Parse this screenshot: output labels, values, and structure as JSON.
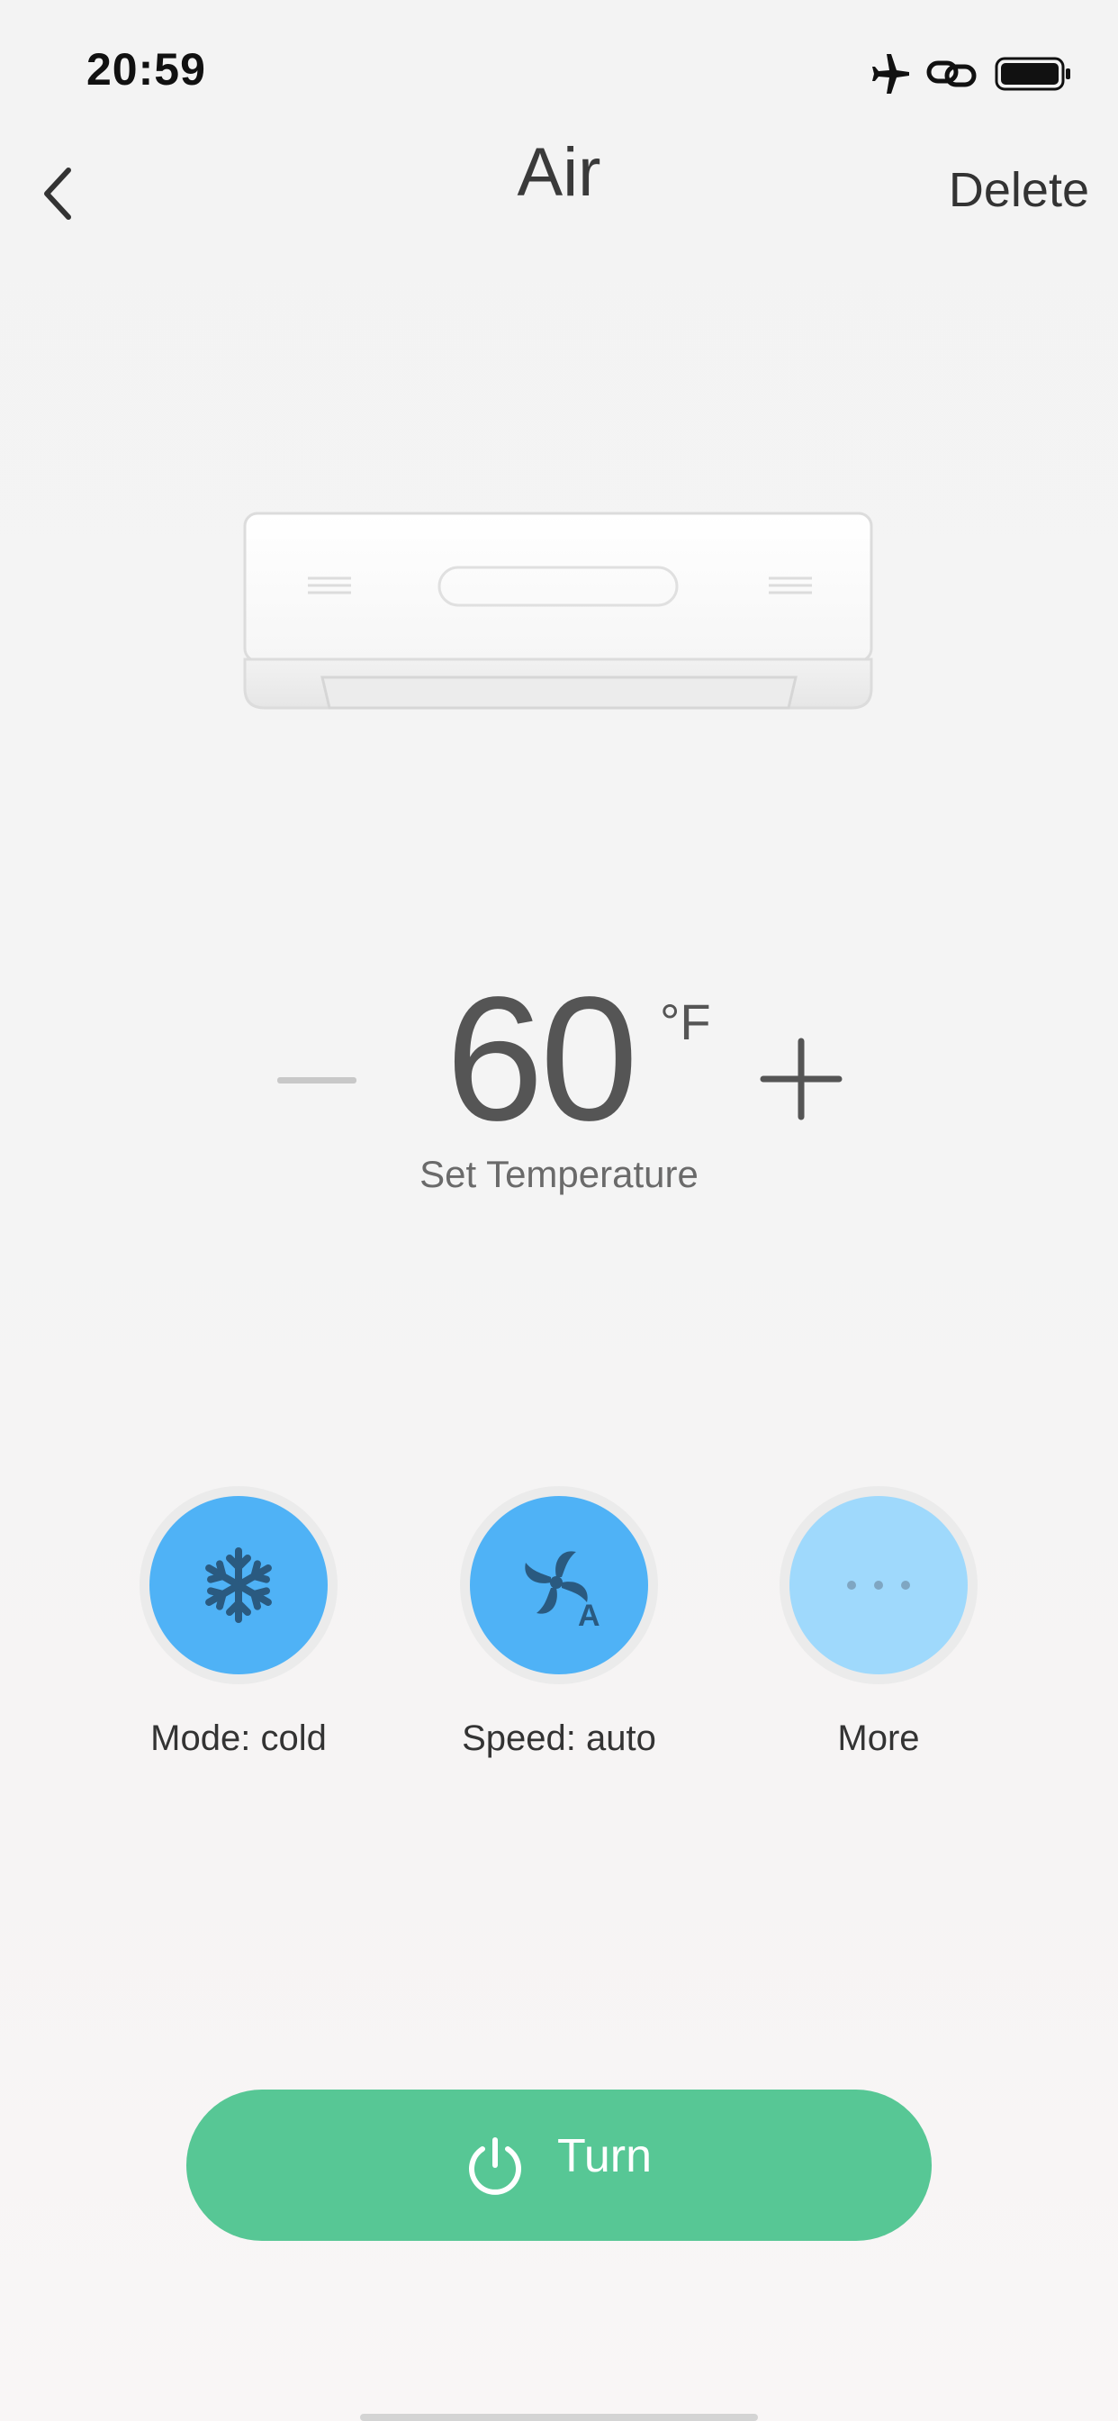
{
  "status_bar": {
    "time": "20:59",
    "icons": [
      "airplane-mode-icon",
      "link-icon",
      "battery-icon"
    ]
  },
  "nav": {
    "back_icon": "chevron-left-icon",
    "title": "Air",
    "delete_label": "Delete"
  },
  "device": {
    "image": "air-conditioner-unit"
  },
  "temperature": {
    "value": "60",
    "unit": "°F",
    "label": "Set Temperature",
    "decrease_icon": "minus-icon",
    "increase_icon": "plus-icon"
  },
  "controls": [
    {
      "label": "Mode: cold",
      "icon": "snowflake-icon"
    },
    {
      "label": "Speed: auto",
      "icon": "fan-auto-icon"
    },
    {
      "label": "More",
      "icon": "more-dots-icon"
    }
  ],
  "power": {
    "label": "Turn",
    "icon": "power-icon"
  },
  "colors": {
    "accent_blue": "#4fb2f6",
    "accent_blue_light": "#9fd9fc",
    "power_green": "#57c795",
    "icon_dark": "#2a5a80"
  }
}
